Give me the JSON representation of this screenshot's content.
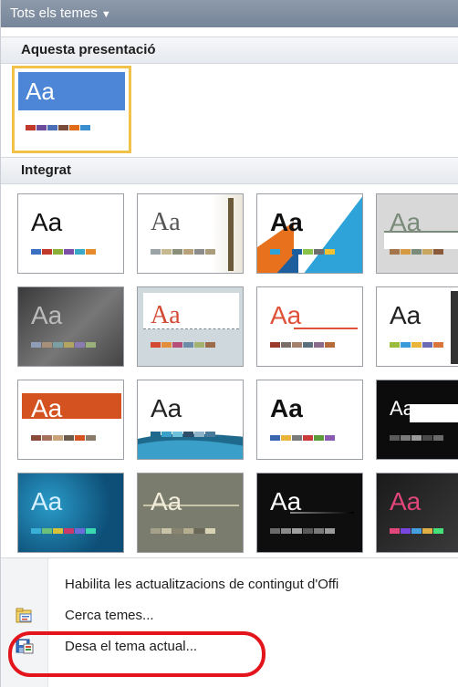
{
  "dropdown": {
    "label": "Tots els temes"
  },
  "sections": {
    "current": "Aquesta presentació",
    "builtin": "Integrat"
  },
  "themes": [
    {
      "label": "Aa"
    },
    {
      "label": "Aa"
    },
    {
      "label": "Aa"
    },
    {
      "label": "Aa"
    },
    {
      "label": "Aa"
    },
    {
      "label": "Aa"
    },
    {
      "label": "Aa"
    },
    {
      "label": "Aa"
    },
    {
      "label": "Aa"
    },
    {
      "label": "Aa"
    },
    {
      "label": "Aa"
    },
    {
      "label": "Aa"
    },
    {
      "label": "Aa"
    },
    {
      "label": "Aa"
    },
    {
      "label": "Aa"
    },
    {
      "label": "Aa"
    }
  ],
  "current_theme": {
    "label": "Aa"
  },
  "commands": {
    "enable_updates": "Habilita les actualitzacions de contingut d'Offi",
    "browse_themes": "Cerca temes...",
    "save_current_theme": "Desa el tema actual..."
  },
  "colors": {
    "header_bg": "#7f8da0",
    "selection_border": "#f0c24a",
    "annotation_red": "#e3141b"
  },
  "icons": {
    "browse": "folder-browse-icon",
    "save": "save-theme-icon"
  }
}
